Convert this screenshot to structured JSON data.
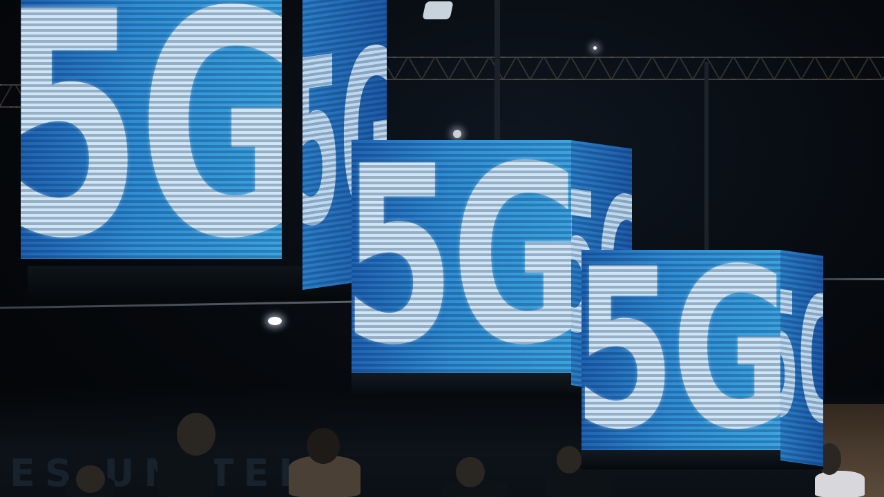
{
  "scene": {
    "description_label": "Trade show hall with hanging LED display cubes",
    "background_color": "#05080c",
    "led_color_primary": "#2f8fd6",
    "led_color_text": "#cfe6f6"
  },
  "cubes": [
    {
      "front_text": "5G",
      "side_text": "5G"
    },
    {
      "front_text": "5G",
      "side_text": "5G"
    },
    {
      "front_text": "5G",
      "side_text": "5G"
    }
  ],
  "banner": {
    "visible_text": "ES UNITEI"
  }
}
